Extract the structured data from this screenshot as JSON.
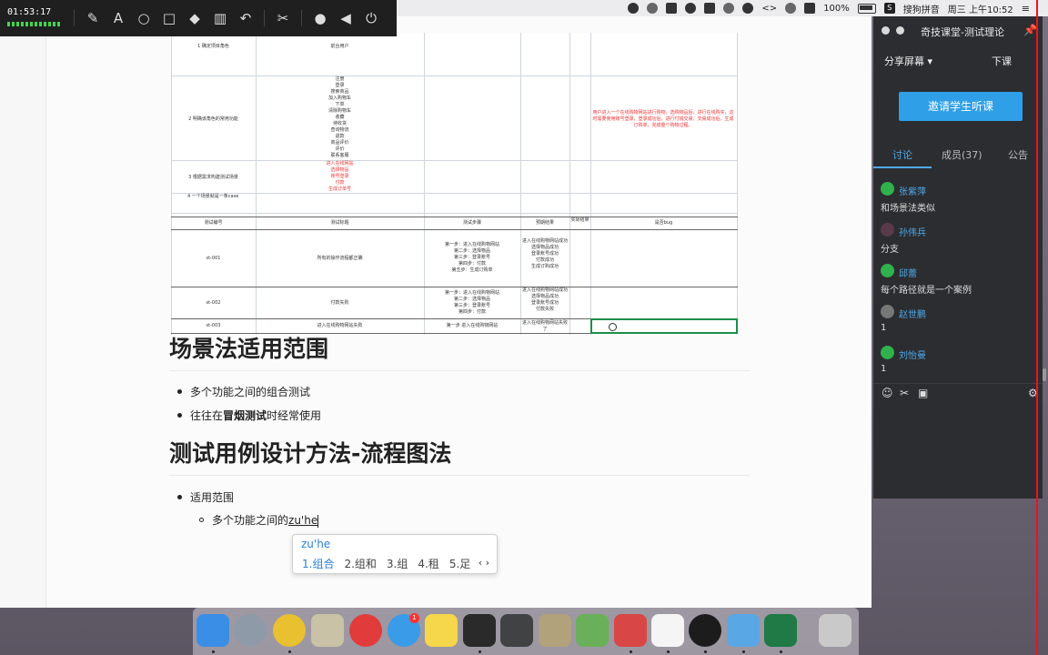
{
  "recorder": {
    "time": "01:53:17",
    "tools": [
      "pen-icon",
      "text-icon",
      "circle-icon",
      "rect-icon",
      "eraser-icon",
      "trash-icon",
      "undo-icon",
      "scissors-icon",
      "mic-icon",
      "speaker-icon",
      "power-icon"
    ]
  },
  "menubar": {
    "battery": "100%",
    "input_method": "搜狗拼音",
    "clock": "周三 上午10:52",
    "ime_badge": "S"
  },
  "sheet": {
    "rows_top": [
      {
        "label": "1 确定项目角色",
        "value": "前台用户"
      },
      {
        "label": "2 明确该角色的常用功能",
        "value": "注册\n登录\n搜索商品\n加入购物车\n下单\n清除购物车\n收藏\n待收货\n查询物流\n退款\n商品评价\n评价\n联系客服"
      },
      {
        "label": "3 根据需求构建测试场景",
        "value": "进入在线网站\n选择物品\n账号登录\n付款\n生成订单号"
      },
      {
        "label": "4 一个场景就是一条case",
        "value": ""
      }
    ],
    "scenario_note": "用户进入一个在线购物网站进行购物，选购物品后，进行在线购买，这时需要使用账号登录，登录成功后，进行付钱交易，交易成功后，生成订购单，完成整个购物过程。",
    "headers": [
      "测试编号",
      "测试标题",
      "测试步骤",
      "预期结果",
      "实际结果",
      "是否bug"
    ],
    "cases": [
      {
        "id": "st-001",
        "title": "所有的操作流程都正确",
        "steps": "第一步：进入在线购物网站\n第二步：选择物品\n第三步：登录账号\n第四步：付款\n第五步：生成订购单",
        "expected": "进入在线购物网站成功\n选择物品成功\n登录账号成功\n付款成功\n生成订购成功"
      },
      {
        "id": "st-002",
        "title": "付款失败",
        "steps": "第一步：进入在线购物网站\n第二步：选择物品\n第三步：登录账号\n第四步：付款",
        "expected": "进入在线购物网站成功\n选择物品成功\n登录账号成功\n付款失败"
      },
      {
        "id": "st-003",
        "title": "进入在线购物网站失败",
        "steps": "第一步 进入在线购物网站",
        "expected": "进入在线购物网站失败了"
      }
    ]
  },
  "doc": {
    "h1_scope": "场景法适用范围",
    "scope_items": [
      "多个功能之间的组合测试",
      "往往在",
      "冒烟测试",
      "时经常使用"
    ],
    "h1_flow": "测试用例设计方法-流程图法",
    "flow_item": "适用范围",
    "flow_sub_prefix": "多个功能之间的",
    "flow_sub_composing": "zu'he"
  },
  "ime": {
    "composition": "zu'he",
    "candidates": [
      "1.组合",
      "2.组和",
      "3.组",
      "4.租",
      "5.足"
    ],
    "arrows": "‹ ›"
  },
  "sidebar": {
    "title": "奇技课堂-测试理论",
    "share_label": "分享屏幕 ▾",
    "end_class": "下课",
    "invite": "邀请学生听课",
    "tabs": [
      "讨论",
      "成员(37)",
      "公告"
    ],
    "messages": [
      {
        "name": "张紫萍",
        "text": "和场景法类似"
      },
      {
        "name": "孙伟兵",
        "text": "分支"
      },
      {
        "name": "邱蕾",
        "text": "每个路径就是一个案例"
      },
      {
        "name": "赵世鹏",
        "text": "1"
      },
      {
        "name": "刘怡曼",
        "text": "1"
      }
    ]
  },
  "dock": {
    "apps": [
      "finder",
      "launchpad",
      "chrome",
      "textedit-preview",
      "netease-music",
      "app-store",
      "notes",
      "evernote",
      "sublime-text",
      "system-prefs",
      "maps",
      "parallels",
      "typora",
      "obs",
      "xcode",
      "excel",
      "trash"
    ],
    "app_store_badge": "1"
  }
}
